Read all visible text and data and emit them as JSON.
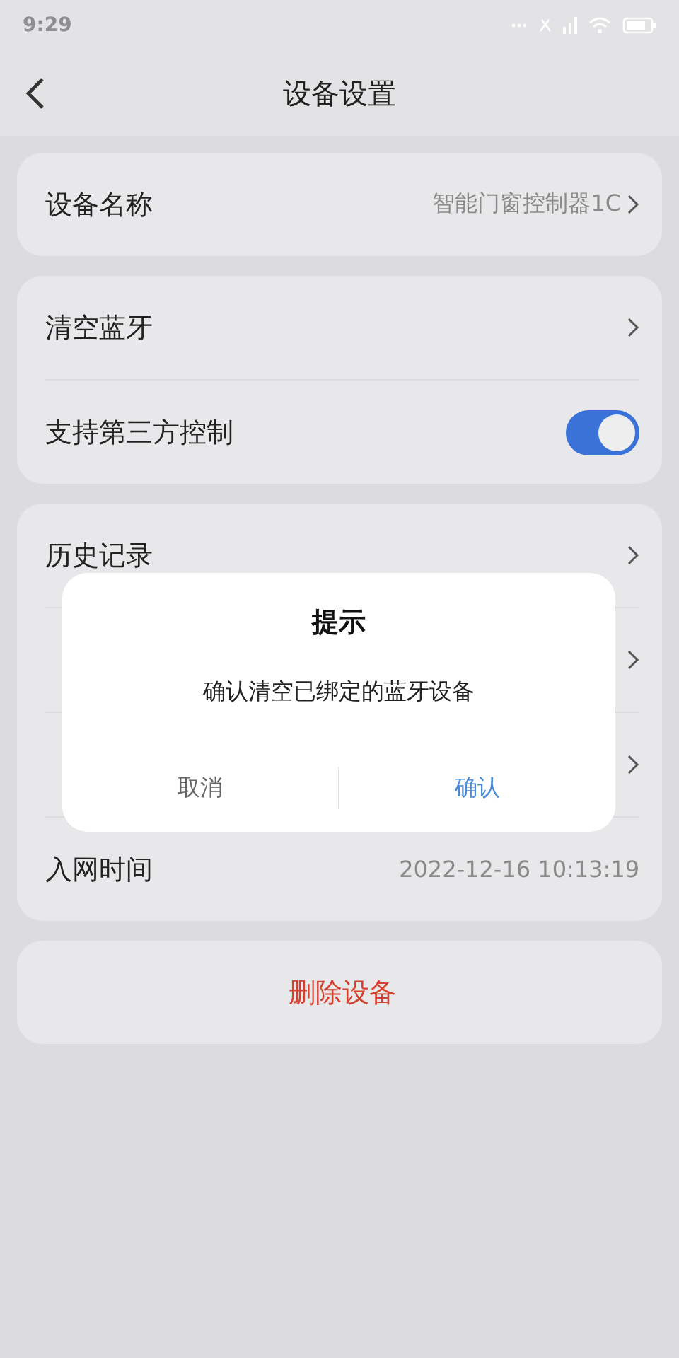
{
  "status_bar": {
    "time": "9:29"
  },
  "header": {
    "title": "设备设置"
  },
  "groups": [
    {
      "rows": [
        {
          "kind": "link",
          "label": "设备名称",
          "value": "智能门窗控制器1C"
        }
      ]
    },
    {
      "rows": [
        {
          "kind": "link",
          "label": "清空蓝牙"
        },
        {
          "kind": "toggle",
          "label": "支持第三方控制",
          "on": true
        }
      ]
    },
    {
      "rows": [
        {
          "kind": "link",
          "label": "历史记录"
        },
        {
          "kind": "link"
        },
        {
          "kind": "link"
        },
        {
          "kind": "info",
          "label": "入网时间",
          "value": "2022-12-16 10:13:19"
        }
      ]
    }
  ],
  "delete_button": "删除设备",
  "dialog": {
    "title": "提示",
    "message": "确认清空已绑定的蓝牙设备",
    "buttons": [
      {
        "label": "取消",
        "kind": "cancel"
      },
      {
        "label": "确认",
        "kind": "confirm"
      }
    ]
  }
}
